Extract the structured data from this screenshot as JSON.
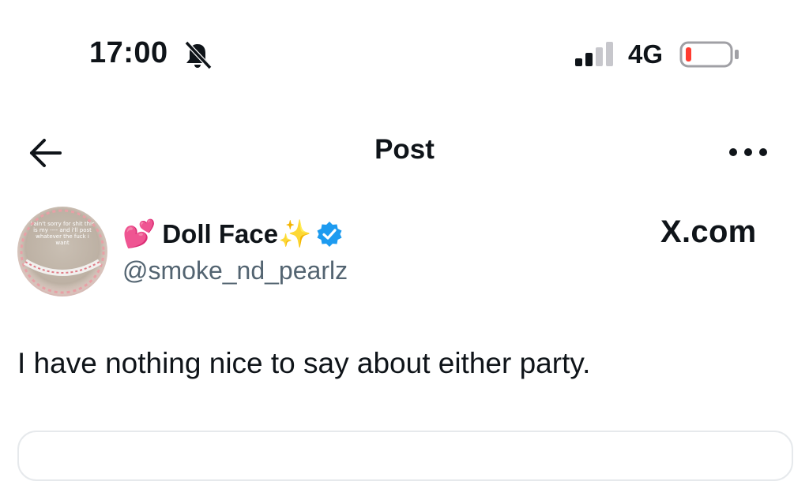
{
  "status_bar": {
    "time": "17:00",
    "network": "4G",
    "battery_level": 0.08,
    "signal_bars_active": 2,
    "signal_bars_total": 4
  },
  "header": {
    "title": "Post"
  },
  "post": {
    "author": {
      "name": "Doll Face",
      "name_prefix_emoji": "💕",
      "name_suffix_emoji": "✨",
      "handle": "@smoke_nd_pearlz",
      "verified": true,
      "avatar_text": "i ain't sorry for shit this is my ---- and i'll post whatever the fuck i want"
    },
    "source_brand": "X.com",
    "text": "I have nothing nice to say about either party."
  },
  "colors": {
    "verified_blue": "#1d9bf0",
    "secondary_text": "#536471",
    "battery_low": "#ff3b30"
  }
}
